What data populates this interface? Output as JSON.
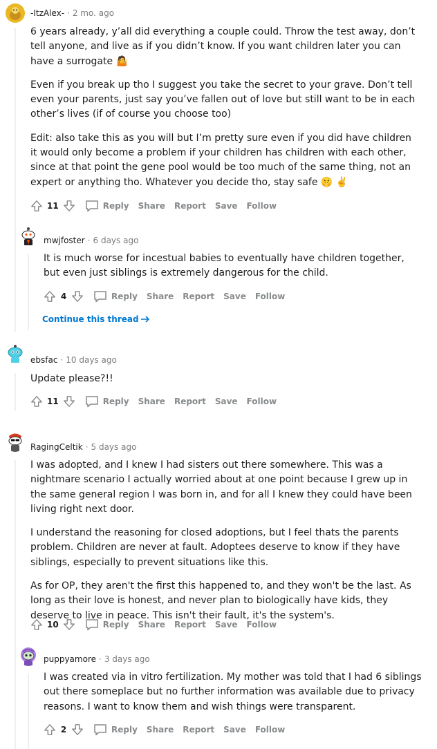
{
  "comments": [
    {
      "username": "-ItzAlex-",
      "age": "2 mo. ago",
      "paragraphs": [
        "6 years already, y’all did everything a couple could. Throw the test away, don’t tell anyone, and live as if you didn’t know. If you want children later you can have a surrogate 🤷",
        "Even if you break up tho I suggest you take the secret to your grave. Don’t tell even your parents, just say you’ve fallen out of love but still want to be in each other’s lives (if of course you choose too)",
        "Edit: also take this as you will but I’m pretty sure even if you did have children it would only become a problem if your children has children with each other, since at that point the gene pool would be too much of the same thing, not an expert or anything tho. Whatever you decide tho, stay safe 🤫 ✌️"
      ],
      "score": "11"
    },
    {
      "username": "mwjfoster",
      "age": "6 days ago",
      "paragraphs": [
        "It is much worse for incestual babies to eventually have children together, but even just siblings is extremely dangerous for the child."
      ],
      "score": "4"
    },
    {
      "username": "ebsfac",
      "age": "10 days ago",
      "paragraphs": [
        "Update please?!!"
      ],
      "score": "11"
    },
    {
      "username": "RagingCeltik",
      "age": "5 days ago",
      "paragraphs": [
        "I was adopted, and I knew I had sisters out there somewhere. This was a nightmare scenario I actually worried about at one point because I grew up in the same general region I was born in, and for all I knew they could have been living right next door.",
        "I understand the reasoning for closed adoptions, but I feel thats the parents problem. Children are never at fault. Adoptees deserve to know if they have siblings, especially to prevent situations like this.",
        "As for OP, they aren't the first this happened to, and they won't be the last. As long as their love is honest, and never plan to biologically have kids, they deserve to live in peace. This isn't their fault, it's the system's."
      ],
      "score": "10"
    },
    {
      "username": "puppyamore",
      "age": "3 days ago",
      "paragraphs": [
        "I was created via in vitro fertilization. My mother was told that I had 6 siblings out there someplace but no further information was available due to privacy reasons. I want to know them and wish things were transparent."
      ],
      "score": "2"
    }
  ],
  "actions": {
    "reply": "Reply",
    "share": "Share",
    "report": "Report",
    "save": "Save",
    "follow": "Follow"
  },
  "continue_thread": "Continue this thread",
  "colors": {
    "link": "#0079d3",
    "meta": "#7c7c7c",
    "action": "#878a8c",
    "thread": "#edeff1"
  }
}
